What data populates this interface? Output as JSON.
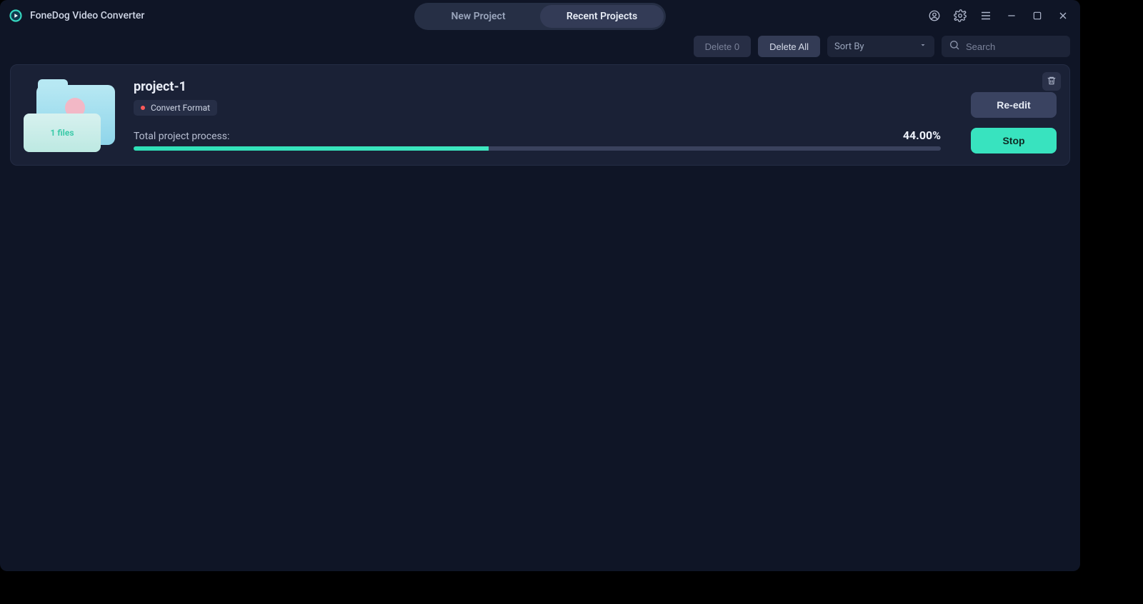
{
  "app": {
    "title": "FoneDog Video Converter"
  },
  "tabs": {
    "new_project": "New Project",
    "recent_projects": "Recent Projects",
    "active": "recent"
  },
  "toolbar": {
    "delete_selected_label": "Delete 0",
    "delete_all_label": "Delete All",
    "sort_by_label": "Sort By",
    "search_placeholder": "Search"
  },
  "project": {
    "title": "project-1",
    "tag_label": "Convert Format",
    "files_label": "1 files",
    "process_label": "Total project process:",
    "progress_text": "44.00%",
    "progress_value": 44,
    "reedit_label": "Re-edit",
    "stop_label": "Stop"
  }
}
